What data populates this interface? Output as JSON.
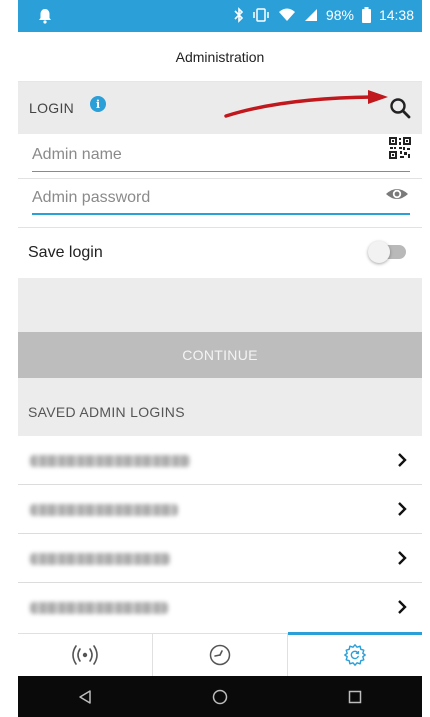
{
  "status_bar": {
    "battery": "98%",
    "time": "14:38"
  },
  "header": {
    "title": "Administration"
  },
  "login": {
    "section_label": "LOGIN",
    "admin_name_placeholder": "Admin name",
    "admin_password_placeholder": "Admin password",
    "save_login_label": "Save login",
    "save_login_on": false,
    "continue_label": "CONTINUE"
  },
  "saved_logins": {
    "section_label": "SAVED ADMIN LOGINS",
    "items": [
      {
        "name": "",
        "icon": "chevron-right-icon"
      },
      {
        "name": "",
        "icon": "chevron-right-icon"
      },
      {
        "name": "",
        "icon": "chevron-right-icon"
      },
      {
        "name": "",
        "icon": "chevron-right-icon"
      }
    ]
  },
  "tabs": [
    {
      "icon": "broadcast-icon",
      "active": false
    },
    {
      "icon": "gauge-icon",
      "active": false
    },
    {
      "icon": "settings-icon",
      "active": true
    }
  ],
  "colors": {
    "accent": "#2a9fd8",
    "annotation_arrow": "#c0181c"
  }
}
